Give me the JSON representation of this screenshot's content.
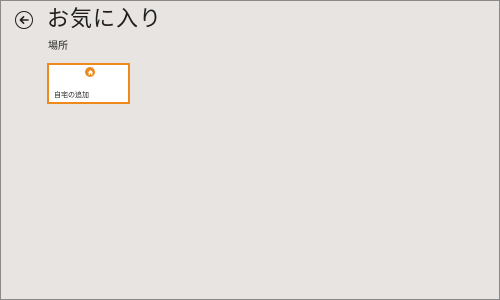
{
  "header": {
    "title": "お気に入り",
    "back_icon": "back-arrow-circle-icon"
  },
  "sections": [
    {
      "label": "場所",
      "tiles": [
        {
          "label": "自宅の追加",
          "icon": "home-icon",
          "accent_color": "#ee8a1c"
        }
      ]
    }
  ],
  "colors": {
    "background": "#e8e4e1",
    "accent": "#ee8a1c",
    "tile_background": "#ffffff"
  }
}
